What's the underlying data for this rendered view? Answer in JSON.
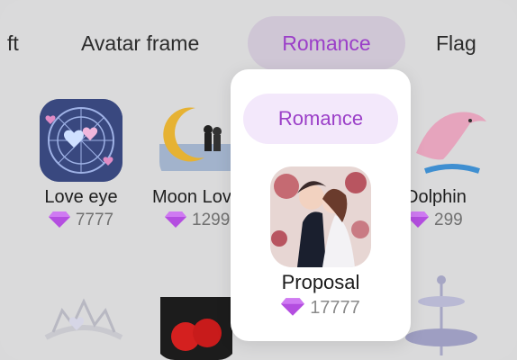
{
  "tabs": [
    {
      "label": "ft"
    },
    {
      "label": "Avatar frame"
    },
    {
      "label": "Romance",
      "active": true
    },
    {
      "label": "Flag"
    }
  ],
  "grid": [
    {
      "name": "Love eye",
      "price": "7777"
    },
    {
      "name": "Moon Lov",
      "price": "1299"
    },
    {
      "name": "Dolphin",
      "price": "299"
    }
  ],
  "popover": {
    "category": "Romance",
    "item_name": "Proposal",
    "price": "17777"
  },
  "colors": {
    "accent": "#9b3fc8",
    "gem": "#b44ee0"
  }
}
